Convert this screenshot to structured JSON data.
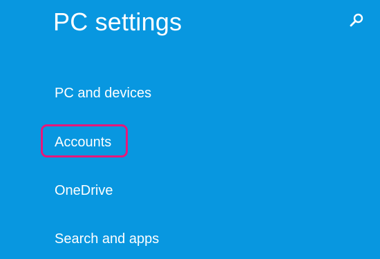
{
  "header": {
    "title": "PC settings",
    "search_icon": "search-icon"
  },
  "nav": {
    "items": [
      {
        "label": "PC and devices"
      },
      {
        "label": "Accounts",
        "highlighted": true
      },
      {
        "label": "OneDrive"
      },
      {
        "label": "Search and apps"
      }
    ]
  },
  "colors": {
    "background": "#0897e0",
    "text": "#ffffff",
    "highlight_border": "#e8177a"
  }
}
